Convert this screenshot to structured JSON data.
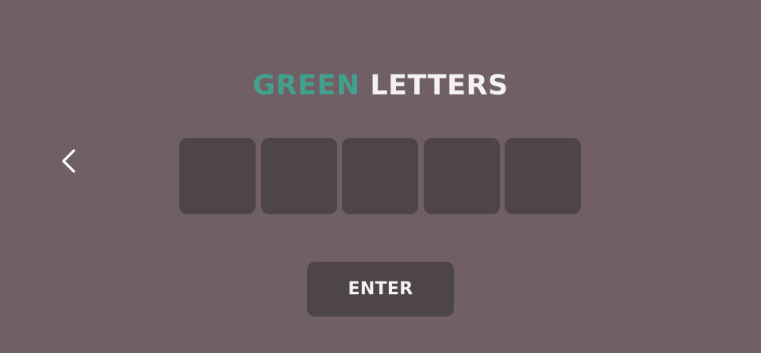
{
  "title": {
    "word_green": "GREEN",
    "word_white": "LETTERS"
  },
  "nav": {
    "back_icon": "chevron-left-icon"
  },
  "tiles": [
    "",
    "",
    "",
    "",
    ""
  ],
  "enter_button": {
    "label": "ENTER"
  },
  "colors": {
    "background": "#705f64",
    "accent_green": "#43a08e",
    "tile": "#4d4547",
    "text": "#f4f1f2"
  }
}
